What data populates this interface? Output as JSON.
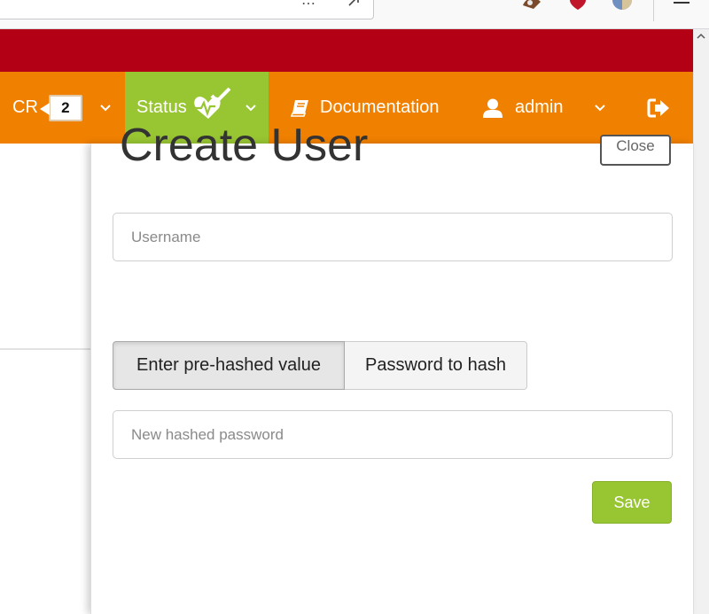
{
  "browser": {
    "url_more": "…"
  },
  "navbar": {
    "cr_label": "CR",
    "cr_count": "2",
    "status_label": "Status",
    "docs_label": "Documentation",
    "user_label": "admin",
    "bg_color": "#f08000",
    "status_color": "#98c532",
    "band_color": "#b40014"
  },
  "modal": {
    "title": "Create User",
    "close_label": "Close",
    "username_placeholder": "Username",
    "segments": [
      "Enter pre-hashed value",
      "Password to hash"
    ],
    "active_segment": "Enter pre-hashed value",
    "password_placeholder": "New hashed password",
    "save_label": "Save",
    "save_color": "#98c532"
  },
  "icons": {
    "status": "heartbeat-check-icon",
    "docs": "book-icon",
    "user": "user-icon",
    "logout": "sign-out-icon",
    "chevron": "chevron-down-icon",
    "menu": "hamburger-icon"
  }
}
